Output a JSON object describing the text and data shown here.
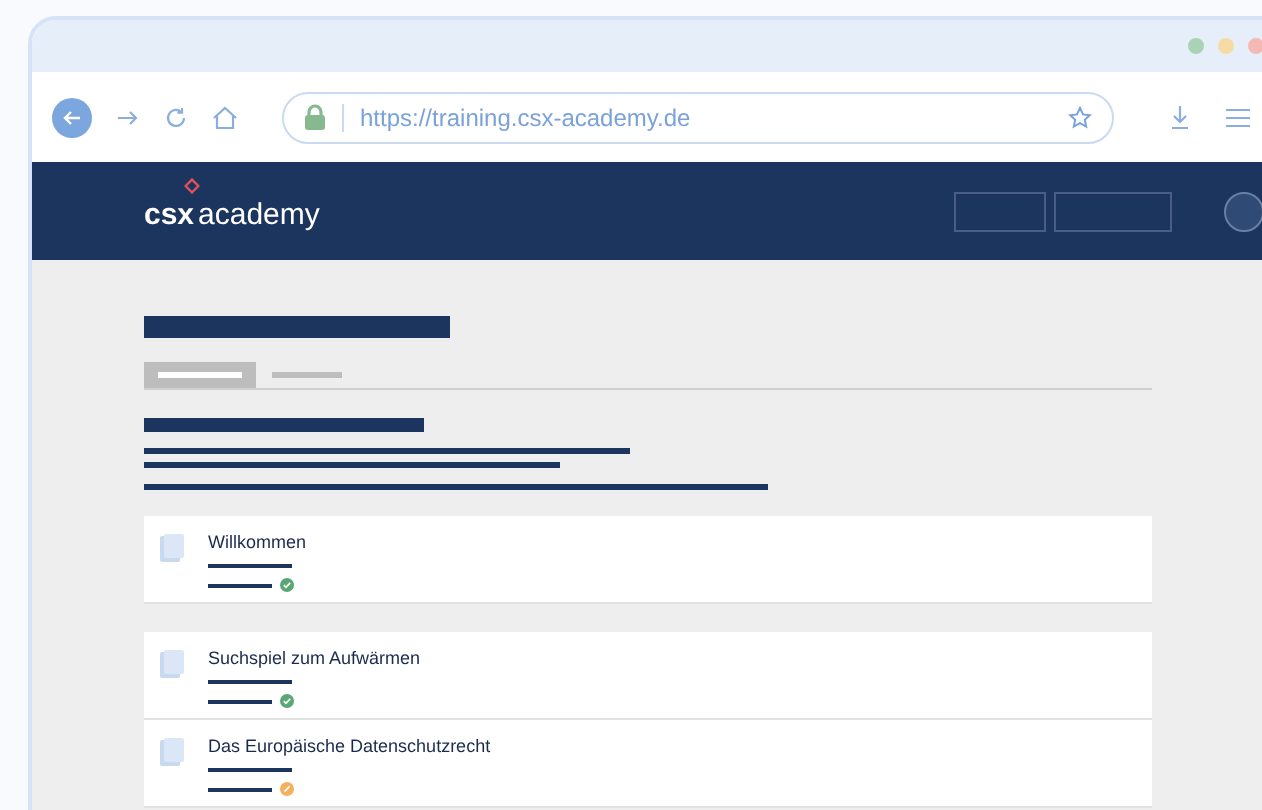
{
  "browser": {
    "url": "https://training.csx-academy.de"
  },
  "header": {
    "logo_bold": "csx",
    "logo_text": "academy"
  },
  "lessons": [
    {
      "title": "Willkommen",
      "completed": true
    },
    {
      "title": "Suchspiel zum Aufwärmen",
      "completed": true
    },
    {
      "title": "Das Europäische Datenschutzrecht",
      "completed": false
    }
  ]
}
